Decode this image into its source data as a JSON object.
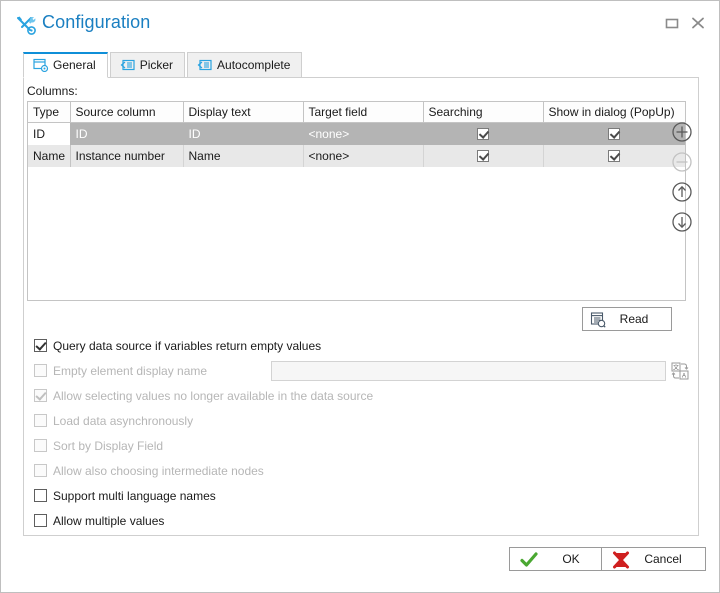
{
  "window": {
    "title": "Configuration",
    "icon": "tools-icon",
    "accent_color": "#1a7fc1",
    "buttons": [
      {
        "name": "restore-button",
        "label": "Restore"
      },
      {
        "name": "close-button",
        "label": "Close"
      }
    ]
  },
  "tabs": [
    {
      "label": "General",
      "icon": "form-gear-icon",
      "active": true
    },
    {
      "label": "Picker",
      "icon": "picker-icon",
      "active": false
    },
    {
      "label": "Autocomplete",
      "icon": "autocomplete-icon",
      "active": false
    }
  ],
  "grid": {
    "label": "Columns:",
    "headers": [
      "Type",
      "Source column",
      "Display text",
      "Target field",
      "Searching",
      "Show in dialog (PopUp)"
    ],
    "rows": [
      {
        "selected": true,
        "type": "ID",
        "source_column": "ID",
        "display_text": "ID",
        "target_field": "<none>",
        "searching": true,
        "show_in_dialog": true
      },
      {
        "selected": false,
        "type": "Name",
        "source_column": "Instance number",
        "display_text": "Name",
        "target_field": "<none>",
        "searching": true,
        "show_in_dialog": true
      }
    ]
  },
  "side_buttons": [
    {
      "name": "add-row-button",
      "icon": "plus-circle-icon",
      "enabled": true
    },
    {
      "name": "remove-row-button",
      "icon": "minus-circle-icon",
      "enabled": false
    },
    {
      "name": "move-up-button",
      "icon": "arrow-up-circle-icon",
      "enabled": true
    },
    {
      "name": "move-down-button",
      "icon": "arrow-down-circle-icon",
      "enabled": true
    }
  ],
  "read_button": {
    "label": "Read",
    "icon": "read-data-icon"
  },
  "options": [
    {
      "label": "Query data source if variables return empty values",
      "checked": true,
      "disabled": false,
      "name": "option-query-data-source"
    },
    {
      "label": "Empty element display name",
      "checked": false,
      "disabled": true,
      "name": "option-empty-element-display-name"
    },
    {
      "label": "Allow selecting values no longer available in the data source",
      "checked": true,
      "disabled": true,
      "name": "option-allow-selecting-unavailable"
    },
    {
      "label": "Load data asynchronously",
      "checked": false,
      "disabled": true,
      "name": "option-load-async"
    },
    {
      "label": "Sort by Display Field",
      "checked": false,
      "disabled": true,
      "name": "option-sort-by-display-field"
    },
    {
      "label": "Allow also choosing intermediate nodes",
      "checked": false,
      "disabled": true,
      "name": "option-allow-intermediate-nodes"
    },
    {
      "label": "Support multi language names",
      "checked": false,
      "disabled": false,
      "name": "option-support-multi-language"
    },
    {
      "label": "Allow multiple values",
      "checked": false,
      "disabled": false,
      "name": "option-allow-multiple-values"
    }
  ],
  "empty_element_input": {
    "value": "",
    "placeholder": "",
    "translate_icon": "translate-icon"
  },
  "footer": {
    "ok_label": "OK",
    "cancel_label": "Cancel",
    "ok_icon": "green-check-icon",
    "cancel_icon": "red-x-icon"
  }
}
